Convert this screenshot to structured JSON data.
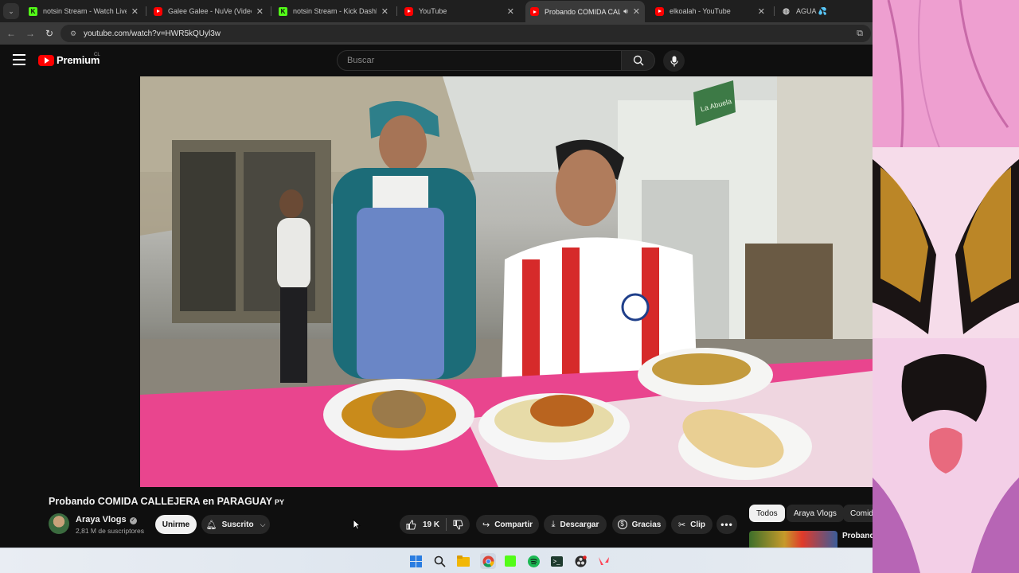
{
  "browser": {
    "tabs": [
      {
        "title": "notsin Stream - Watch Live on Kick",
        "favicon": "kick-icon",
        "active": false
      },
      {
        "title": "Galee Galee - NuVe (Video Oficial)",
        "favicon": "youtube-icon",
        "active": false
      },
      {
        "title": "notsin Stream - Kick Dashboard",
        "favicon": "kick-icon",
        "active": false
      },
      {
        "title": "YouTube",
        "favicon": "youtube-icon",
        "active": false
      },
      {
        "title": "Probando COMIDA CALLEJERA en PARAGUAY",
        "favicon": "youtube-icon",
        "active": true,
        "audio": true
      },
      {
        "title": "elkoalah - YouTube",
        "favicon": "youtube-icon",
        "active": false
      },
      {
        "title": "AGUA 💦",
        "favicon": "globe-icon",
        "active": false
      }
    ],
    "url": "youtube.com/watch?v=HWR5kQUyl3w"
  },
  "youtube": {
    "logo_text": "Premium",
    "country_code": "CL",
    "search_placeholder": "Buscar"
  },
  "video": {
    "title": "Probando COMIDA CALLEJERA en PARAGUAY",
    "title_flag": "PY",
    "channel": "Araya Vlogs",
    "subscribers": "2,81 M de suscriptores",
    "join_label": "Unirme",
    "subscribed_label": "Suscrito",
    "likes": "19 K",
    "actions": [
      {
        "name": "share-button",
        "icon": "share-icon",
        "label": "Compartir"
      },
      {
        "name": "download-button",
        "icon": "download-icon",
        "label": "Descargar"
      },
      {
        "name": "thanks-button",
        "icon": "thanks-icon",
        "label": "Gracias"
      },
      {
        "name": "clip-button",
        "icon": "scissors-icon",
        "label": "Clip"
      }
    ],
    "scene_sign": "La Abuela"
  },
  "recommendations": {
    "chips": [
      "Todos",
      "Araya Vlogs",
      "Comida"
    ],
    "first_title": "Probando más BAR"
  },
  "taskbar": {
    "icons": [
      "windows-start-icon",
      "search-icon",
      "file-explorer-icon",
      "chrome-icon",
      "kick-app-icon",
      "spotify-icon",
      "terminal-icon",
      "obs-icon",
      "valorant-icon"
    ]
  },
  "colors": {
    "accent_red": "#ff0000",
    "kick_green": "#53fc18",
    "background": "#0f0f0f",
    "chip_bg": "#272727"
  }
}
